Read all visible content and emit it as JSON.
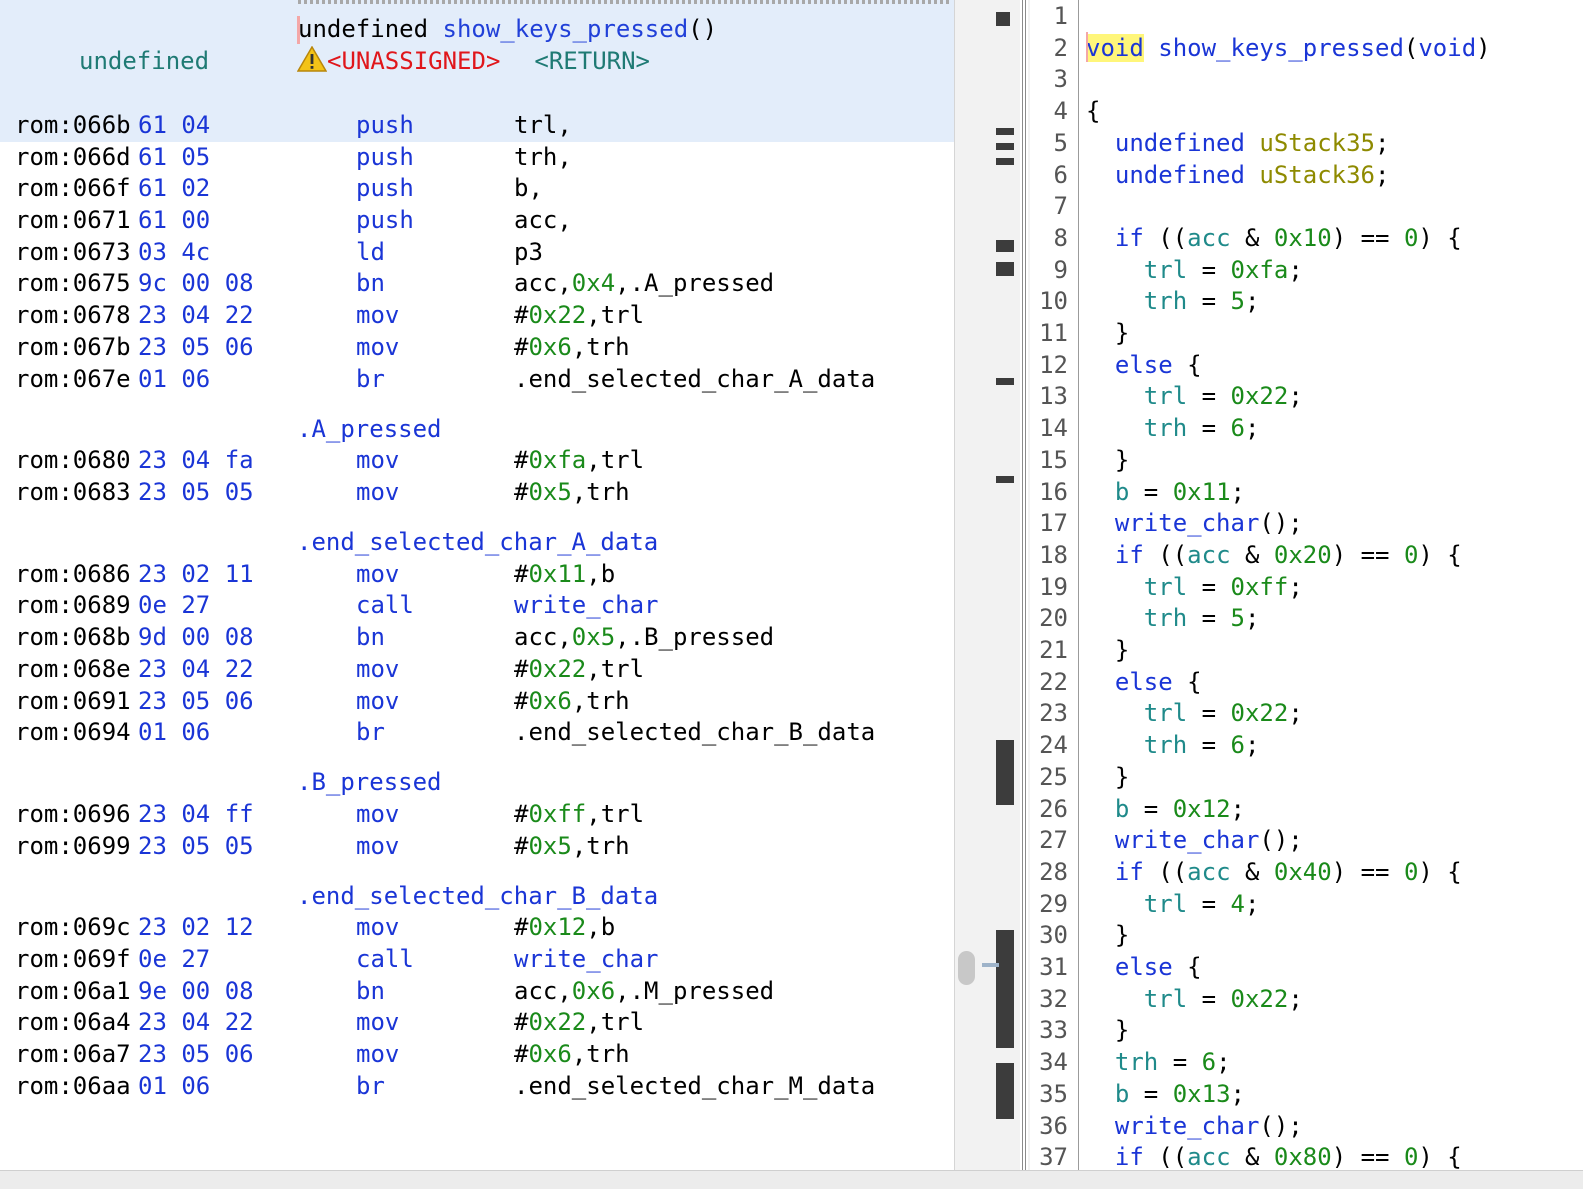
{
  "listing": {
    "return_type": "undefined",
    "signature_ret": "undefined",
    "function_name": "show_keys_pressed",
    "signature_parens": "()",
    "unassigned": "<UNASSIGNED>",
    "return_tag": "<RETURN>",
    "blocks": [
      {
        "type": "row",
        "addr": "rom:066b",
        "bytes": "61 04",
        "mnem": "push",
        "ops": [
          {
            "t": "trl,",
            "c": "plain"
          }
        ]
      },
      {
        "type": "row",
        "addr": "rom:066d",
        "bytes": "61 05",
        "mnem": "push",
        "ops": [
          {
            "t": "trh,",
            "c": "plain"
          }
        ]
      },
      {
        "type": "row",
        "addr": "rom:066f",
        "bytes": "61 02",
        "mnem": "push",
        "ops": [
          {
            "t": "b,",
            "c": "plain"
          }
        ]
      },
      {
        "type": "row",
        "addr": "rom:0671",
        "bytes": "61 00",
        "mnem": "push",
        "ops": [
          {
            "t": "acc,",
            "c": "plain"
          }
        ]
      },
      {
        "type": "row",
        "addr": "rom:0673",
        "bytes": "03 4c",
        "mnem": "ld",
        "ops": [
          {
            "t": "p3",
            "c": "plain"
          }
        ]
      },
      {
        "type": "row",
        "addr": "rom:0675",
        "bytes": "9c 00 08",
        "mnem": "bn",
        "ops": [
          {
            "t": "acc,",
            "c": "plain"
          },
          {
            "t": "0x4",
            "c": "num"
          },
          {
            "t": ",.A_pressed",
            "c": "plain"
          }
        ]
      },
      {
        "type": "row",
        "addr": "rom:0678",
        "bytes": "23 04 22",
        "mnem": "mov",
        "ops": [
          {
            "t": "#",
            "c": "plain"
          },
          {
            "t": "0x22",
            "c": "num"
          },
          {
            "t": ",trl",
            "c": "plain"
          }
        ]
      },
      {
        "type": "row",
        "addr": "rom:067b",
        "bytes": "23 05 06",
        "mnem": "mov",
        "ops": [
          {
            "t": "#",
            "c": "plain"
          },
          {
            "t": "0x6",
            "c": "num"
          },
          {
            "t": ",trh",
            "c": "plain"
          }
        ]
      },
      {
        "type": "row",
        "addr": "rom:067e",
        "bytes": "01 06",
        "mnem": "br",
        "ops": [
          {
            "t": ".end_selected_char_A_data",
            "c": "plain"
          }
        ]
      },
      {
        "type": "label",
        "text": ".A_pressed"
      },
      {
        "type": "row",
        "addr": "rom:0680",
        "bytes": "23 04 fa",
        "mnem": "mov",
        "ops": [
          {
            "t": "#",
            "c": "plain"
          },
          {
            "t": "0xfa",
            "c": "num"
          },
          {
            "t": ",trl",
            "c": "plain"
          }
        ]
      },
      {
        "type": "row",
        "addr": "rom:0683",
        "bytes": "23 05 05",
        "mnem": "mov",
        "ops": [
          {
            "t": "#",
            "c": "plain"
          },
          {
            "t": "0x5",
            "c": "num"
          },
          {
            "t": ",trh",
            "c": "plain"
          }
        ]
      },
      {
        "type": "label",
        "text": ".end_selected_char_A_data"
      },
      {
        "type": "row",
        "addr": "rom:0686",
        "bytes": "23 02 11",
        "mnem": "mov",
        "ops": [
          {
            "t": "#",
            "c": "plain"
          },
          {
            "t": "0x11",
            "c": "num"
          },
          {
            "t": ",b",
            "c": "plain"
          }
        ]
      },
      {
        "type": "row",
        "addr": "rom:0689",
        "bytes": "0e 27",
        "mnem": "call",
        "ops": [
          {
            "t": "write_char",
            "c": "lbl"
          }
        ]
      },
      {
        "type": "row",
        "addr": "rom:068b",
        "bytes": "9d 00 08",
        "mnem": "bn",
        "ops": [
          {
            "t": "acc,",
            "c": "plain"
          },
          {
            "t": "0x5",
            "c": "num"
          },
          {
            "t": ",.B_pressed",
            "c": "plain"
          }
        ]
      },
      {
        "type": "row",
        "addr": "rom:068e",
        "bytes": "23 04 22",
        "mnem": "mov",
        "ops": [
          {
            "t": "#",
            "c": "plain"
          },
          {
            "t": "0x22",
            "c": "num"
          },
          {
            "t": ",trl",
            "c": "plain"
          }
        ]
      },
      {
        "type": "row",
        "addr": "rom:0691",
        "bytes": "23 05 06",
        "mnem": "mov",
        "ops": [
          {
            "t": "#",
            "c": "plain"
          },
          {
            "t": "0x6",
            "c": "num"
          },
          {
            "t": ",trh",
            "c": "plain"
          }
        ]
      },
      {
        "type": "row",
        "addr": "rom:0694",
        "bytes": "01 06",
        "mnem": "br",
        "ops": [
          {
            "t": ".end_selected_char_B_data",
            "c": "plain"
          }
        ]
      },
      {
        "type": "label",
        "text": ".B_pressed"
      },
      {
        "type": "row",
        "addr": "rom:0696",
        "bytes": "23 04 ff",
        "mnem": "mov",
        "ops": [
          {
            "t": "#",
            "c": "plain"
          },
          {
            "t": "0xff",
            "c": "num"
          },
          {
            "t": ",trl",
            "c": "plain"
          }
        ]
      },
      {
        "type": "row",
        "addr": "rom:0699",
        "bytes": "23 05 05",
        "mnem": "mov",
        "ops": [
          {
            "t": "#",
            "c": "plain"
          },
          {
            "t": "0x5",
            "c": "num"
          },
          {
            "t": ",trh",
            "c": "plain"
          }
        ]
      },
      {
        "type": "label",
        "text": ".end_selected_char_B_data"
      },
      {
        "type": "row",
        "addr": "rom:069c",
        "bytes": "23 02 12",
        "mnem": "mov",
        "ops": [
          {
            "t": "#",
            "c": "plain"
          },
          {
            "t": "0x12",
            "c": "num"
          },
          {
            "t": ",b",
            "c": "plain"
          }
        ]
      },
      {
        "type": "row",
        "addr": "rom:069f",
        "bytes": "0e 27",
        "mnem": "call",
        "ops": [
          {
            "t": "write_char",
            "c": "lbl"
          }
        ]
      },
      {
        "type": "row",
        "addr": "rom:06a1",
        "bytes": "9e 00 08",
        "mnem": "bn",
        "ops": [
          {
            "t": "acc,",
            "c": "plain"
          },
          {
            "t": "0x6",
            "c": "num"
          },
          {
            "t": ",.M_pressed",
            "c": "plain"
          }
        ]
      },
      {
        "type": "row",
        "addr": "rom:06a4",
        "bytes": "23 04 22",
        "mnem": "mov",
        "ops": [
          {
            "t": "#",
            "c": "plain"
          },
          {
            "t": "0x22",
            "c": "num"
          },
          {
            "t": ",trl",
            "c": "plain"
          }
        ]
      },
      {
        "type": "row",
        "addr": "rom:06a7",
        "bytes": "23 05 06",
        "mnem": "mov",
        "ops": [
          {
            "t": "#",
            "c": "plain"
          },
          {
            "t": "0x6",
            "c": "num"
          },
          {
            "t": ",trh",
            "c": "plain"
          }
        ]
      },
      {
        "type": "row",
        "addr": "rom:06aa",
        "bytes": "01 06",
        "mnem": "br",
        "ops": [
          {
            "t": ".end_selected_char_M_data",
            "c": "plain"
          }
        ]
      }
    ]
  },
  "decompiler": {
    "lines": [
      [],
      [
        {
          "t": "void",
          "c": "ty hl"
        },
        {
          "t": " "
        },
        {
          "t": "show_keys_pressed",
          "c": "fn"
        },
        {
          "t": "("
        },
        {
          "t": "void",
          "c": "ty"
        },
        {
          "t": ")"
        }
      ],
      [],
      [
        {
          "t": "{"
        }
      ],
      [
        {
          "t": "  "
        },
        {
          "t": "undefined",
          "c": "ty"
        },
        {
          "t": " "
        },
        {
          "t": "uStack35",
          "c": "var"
        },
        {
          "t": ";"
        }
      ],
      [
        {
          "t": "  "
        },
        {
          "t": "undefined",
          "c": "ty"
        },
        {
          "t": " "
        },
        {
          "t": "uStack36",
          "c": "var"
        },
        {
          "t": ";"
        }
      ],
      [],
      [
        {
          "t": "  "
        },
        {
          "t": "if",
          "c": "kw"
        },
        {
          "t": " (("
        },
        {
          "t": "acc",
          "c": "reg"
        },
        {
          "t": " & "
        },
        {
          "t": "0x10",
          "c": "num"
        },
        {
          "t": ") == "
        },
        {
          "t": "0",
          "c": "num"
        },
        {
          "t": ") {"
        }
      ],
      [
        {
          "t": "    "
        },
        {
          "t": "trl",
          "c": "reg"
        },
        {
          "t": " = "
        },
        {
          "t": "0xfa",
          "c": "num"
        },
        {
          "t": ";"
        }
      ],
      [
        {
          "t": "    "
        },
        {
          "t": "trh",
          "c": "reg"
        },
        {
          "t": " = "
        },
        {
          "t": "5",
          "c": "num"
        },
        {
          "t": ";"
        }
      ],
      [
        {
          "t": "  }"
        }
      ],
      [
        {
          "t": "  "
        },
        {
          "t": "else",
          "c": "kw"
        },
        {
          "t": " {"
        }
      ],
      [
        {
          "t": "    "
        },
        {
          "t": "trl",
          "c": "reg"
        },
        {
          "t": " = "
        },
        {
          "t": "0x22",
          "c": "num"
        },
        {
          "t": ";"
        }
      ],
      [
        {
          "t": "    "
        },
        {
          "t": "trh",
          "c": "reg"
        },
        {
          "t": " = "
        },
        {
          "t": "6",
          "c": "num"
        },
        {
          "t": ";"
        }
      ],
      [
        {
          "t": "  }"
        }
      ],
      [
        {
          "t": "  "
        },
        {
          "t": "b",
          "c": "reg"
        },
        {
          "t": " = "
        },
        {
          "t": "0x11",
          "c": "num"
        },
        {
          "t": ";"
        }
      ],
      [
        {
          "t": "  "
        },
        {
          "t": "write_char",
          "c": "fn"
        },
        {
          "t": "();"
        }
      ],
      [
        {
          "t": "  "
        },
        {
          "t": "if",
          "c": "kw"
        },
        {
          "t": " (("
        },
        {
          "t": "acc",
          "c": "reg"
        },
        {
          "t": " & "
        },
        {
          "t": "0x20",
          "c": "num"
        },
        {
          "t": ") == "
        },
        {
          "t": "0",
          "c": "num"
        },
        {
          "t": ") {"
        }
      ],
      [
        {
          "t": "    "
        },
        {
          "t": "trl",
          "c": "reg"
        },
        {
          "t": " = "
        },
        {
          "t": "0xff",
          "c": "num"
        },
        {
          "t": ";"
        }
      ],
      [
        {
          "t": "    "
        },
        {
          "t": "trh",
          "c": "reg"
        },
        {
          "t": " = "
        },
        {
          "t": "5",
          "c": "num"
        },
        {
          "t": ";"
        }
      ],
      [
        {
          "t": "  }"
        }
      ],
      [
        {
          "t": "  "
        },
        {
          "t": "else",
          "c": "kw"
        },
        {
          "t": " {"
        }
      ],
      [
        {
          "t": "    "
        },
        {
          "t": "trl",
          "c": "reg"
        },
        {
          "t": " = "
        },
        {
          "t": "0x22",
          "c": "num"
        },
        {
          "t": ";"
        }
      ],
      [
        {
          "t": "    "
        },
        {
          "t": "trh",
          "c": "reg"
        },
        {
          "t": " = "
        },
        {
          "t": "6",
          "c": "num"
        },
        {
          "t": ";"
        }
      ],
      [
        {
          "t": "  }"
        }
      ],
      [
        {
          "t": "  "
        },
        {
          "t": "b",
          "c": "reg"
        },
        {
          "t": " = "
        },
        {
          "t": "0x12",
          "c": "num"
        },
        {
          "t": ";"
        }
      ],
      [
        {
          "t": "  "
        },
        {
          "t": "write_char",
          "c": "fn"
        },
        {
          "t": "();"
        }
      ],
      [
        {
          "t": "  "
        },
        {
          "t": "if",
          "c": "kw"
        },
        {
          "t": " (("
        },
        {
          "t": "acc",
          "c": "reg"
        },
        {
          "t": " & "
        },
        {
          "t": "0x40",
          "c": "num"
        },
        {
          "t": ") == "
        },
        {
          "t": "0",
          "c": "num"
        },
        {
          "t": ") {"
        }
      ],
      [
        {
          "t": "    "
        },
        {
          "t": "trl",
          "c": "reg"
        },
        {
          "t": " = "
        },
        {
          "t": "4",
          "c": "num"
        },
        {
          "t": ";"
        }
      ],
      [
        {
          "t": "  }"
        }
      ],
      [
        {
          "t": "  "
        },
        {
          "t": "else",
          "c": "kw"
        },
        {
          "t": " {"
        }
      ],
      [
        {
          "t": "    "
        },
        {
          "t": "trl",
          "c": "reg"
        },
        {
          "t": " = "
        },
        {
          "t": "0x22",
          "c": "num"
        },
        {
          "t": ";"
        }
      ],
      [
        {
          "t": "  }"
        }
      ],
      [
        {
          "t": "  "
        },
        {
          "t": "trh",
          "c": "reg"
        },
        {
          "t": " = "
        },
        {
          "t": "6",
          "c": "num"
        },
        {
          "t": ";"
        }
      ],
      [
        {
          "t": "  "
        },
        {
          "t": "b",
          "c": "reg"
        },
        {
          "t": " = "
        },
        {
          "t": "0x13",
          "c": "num"
        },
        {
          "t": ";"
        }
      ],
      [
        {
          "t": "  "
        },
        {
          "t": "write_char",
          "c": "fn"
        },
        {
          "t": "();"
        }
      ],
      [
        {
          "t": "  "
        },
        {
          "t": "if",
          "c": "kw"
        },
        {
          "t": " (("
        },
        {
          "t": "acc",
          "c": "reg"
        },
        {
          "t": " & "
        },
        {
          "t": "0x80",
          "c": "num"
        },
        {
          "t": ") == "
        },
        {
          "t": "0",
          "c": "num"
        },
        {
          "t": ") {"
        }
      ]
    ]
  },
  "icons": {
    "warning": "warning-triangle-icon"
  },
  "colors": {
    "highlight_band": "#e3edfa",
    "keyword_blue": "#1a35d6",
    "number_green": "#1a8a1a",
    "register_teal": "#1f8a8a",
    "variable_olive": "#8e8a00",
    "error_red": "#e0161b",
    "selection_yellow": "#fff67a"
  }
}
